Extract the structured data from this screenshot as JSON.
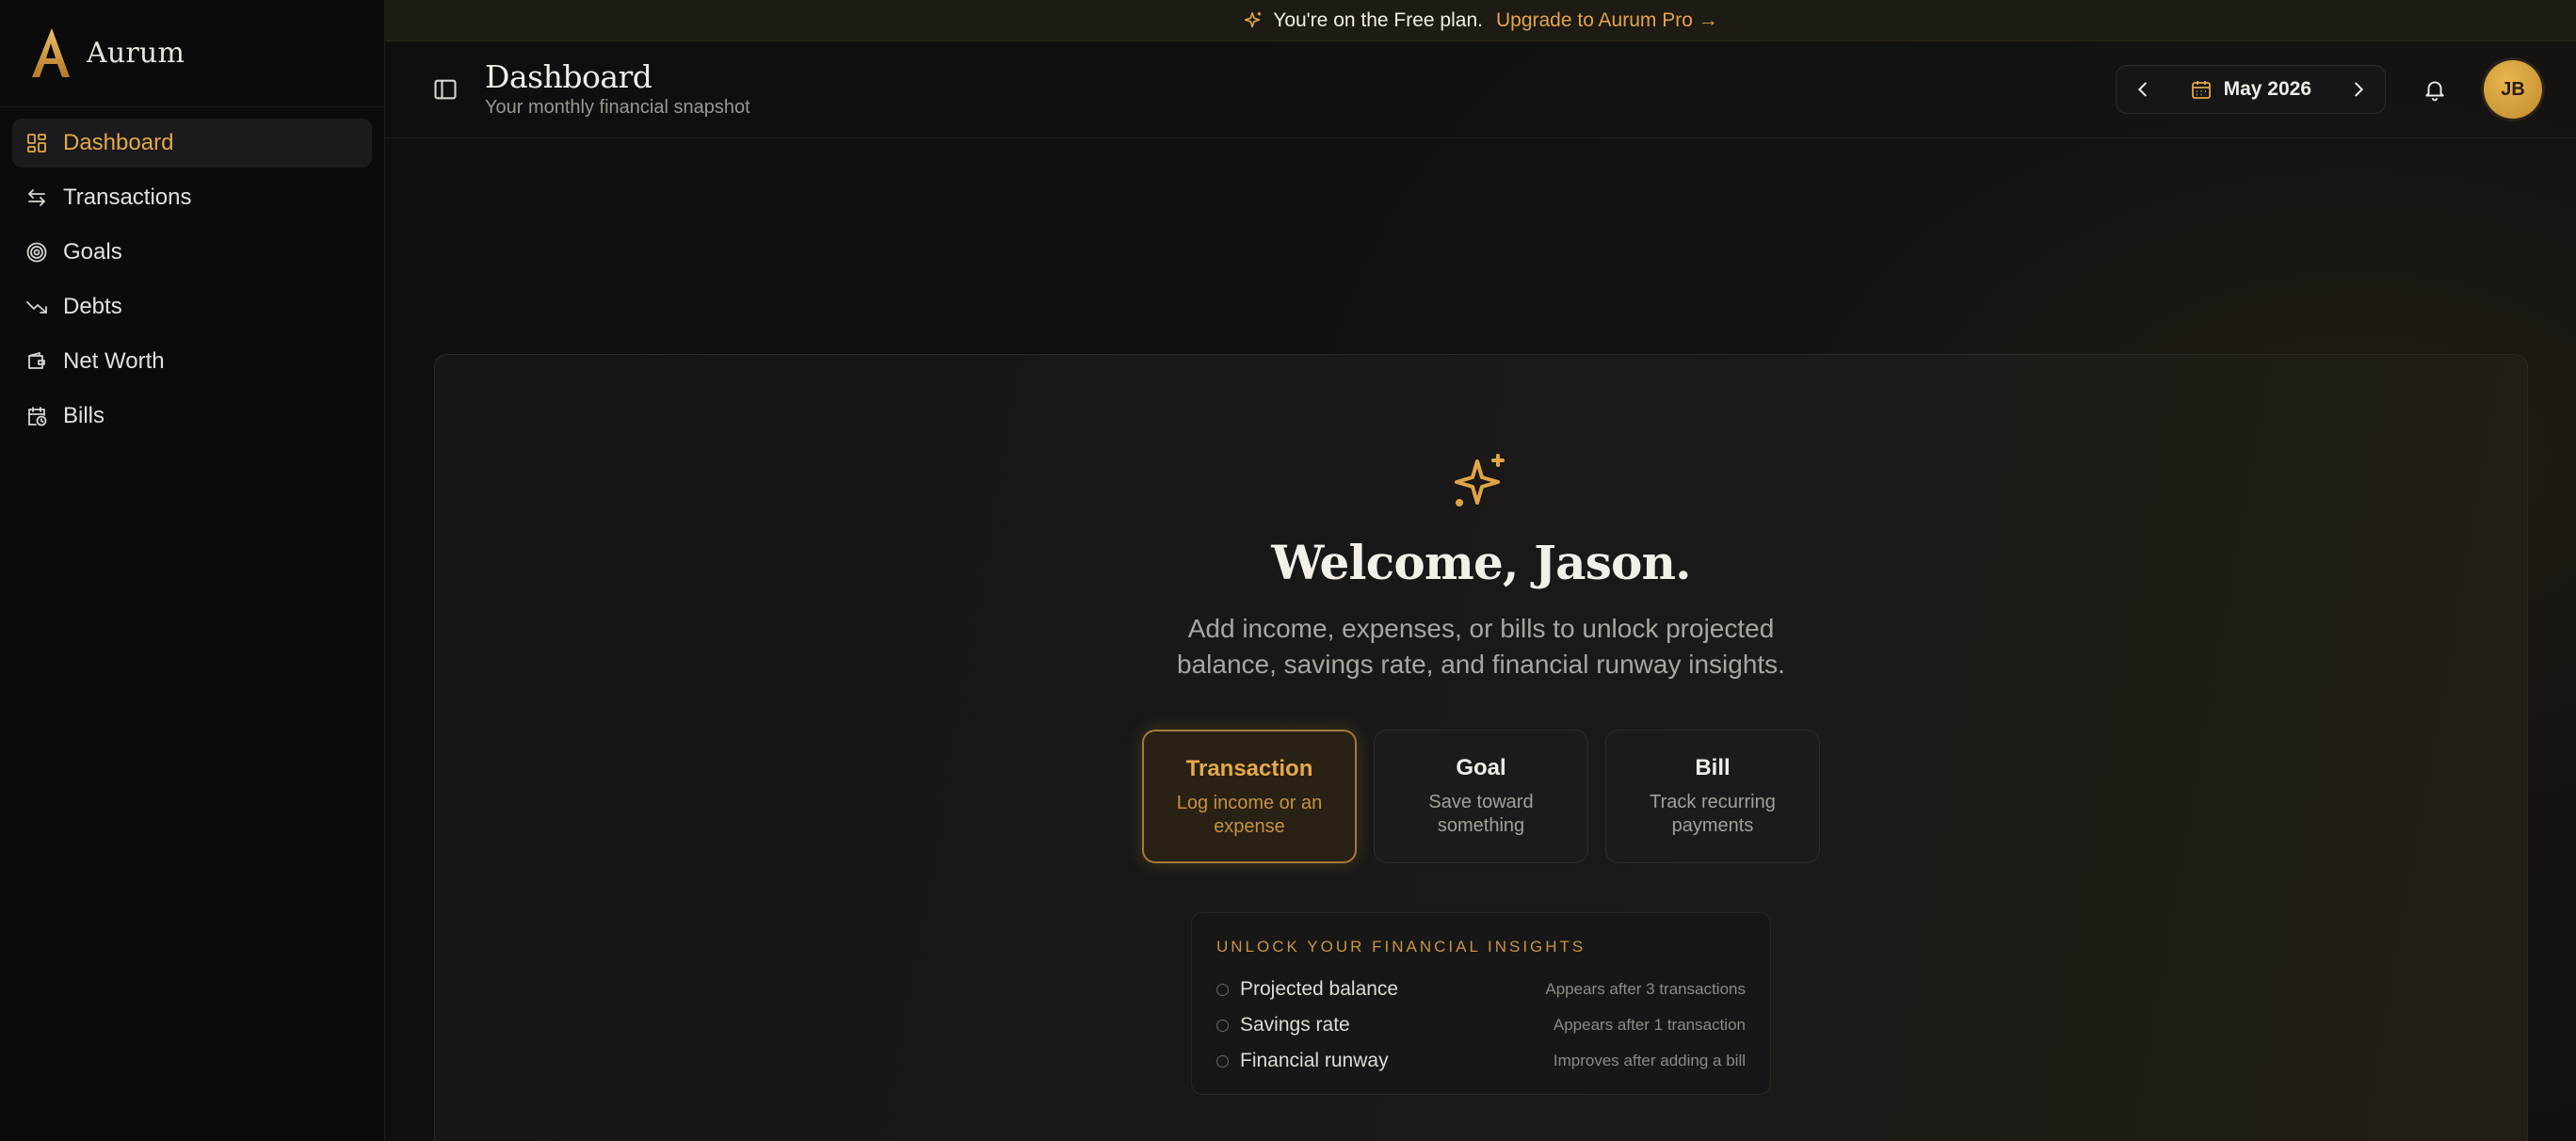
{
  "brand": {
    "name": "Aurum",
    "accent": "#e1a948"
  },
  "sidebar": {
    "items": [
      {
        "label": "Dashboard",
        "icon": "dashboard-grid-icon",
        "active": true
      },
      {
        "label": "Transactions",
        "icon": "arrows-swap-icon",
        "active": false
      },
      {
        "label": "Goals",
        "icon": "target-icon",
        "active": false
      },
      {
        "label": "Debts",
        "icon": "trending-down-icon",
        "active": false
      },
      {
        "label": "Net Worth",
        "icon": "wallet-icon",
        "active": false
      },
      {
        "label": "Bills",
        "icon": "calendar-clock-icon",
        "active": false
      }
    ]
  },
  "banner": {
    "text": "You're on the Free plan.",
    "link": "Upgrade to Aurum Pro →"
  },
  "header": {
    "title": "Dashboard",
    "subtitle": "Your monthly financial snapshot",
    "month": "May 2026",
    "avatar_initials": "JB"
  },
  "welcome": {
    "heading": "Welcome, Jason.",
    "lead": "Add income, expenses, or bills to unlock projected balance, savings rate, and financial runway insights."
  },
  "choices": [
    {
      "title": "Transaction",
      "subtitle": "Log income or an expense",
      "active": true
    },
    {
      "title": "Goal",
      "subtitle": "Save toward something",
      "active": false
    },
    {
      "title": "Bill",
      "subtitle": "Track recurring payments",
      "active": false
    }
  ],
  "insights": {
    "title": "UNLOCK YOUR FINANCIAL INSIGHTS",
    "rows": [
      {
        "label": "Projected balance",
        "note": "Appears after 3 transactions"
      },
      {
        "label": "Savings rate",
        "note": "Appears after 1 transaction"
      },
      {
        "label": "Financial runway",
        "note": "Improves after adding a bill"
      }
    ]
  }
}
